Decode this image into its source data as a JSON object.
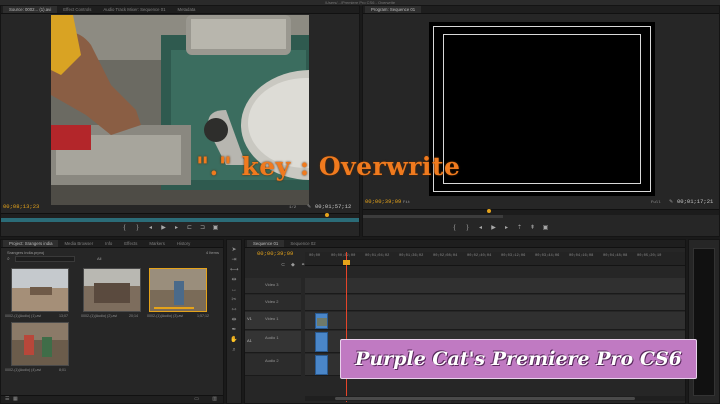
{
  "title_bar": "/Users/.../Premiere Pro CS6 - Overwrite",
  "source_monitor": {
    "tabs": [
      "Source: 0002... (1).avi",
      "Effect Controls",
      "Audio Track Mixer: Sequence 01",
      "Metadata"
    ],
    "timecode_in": "00;08;13;23",
    "fit": "1/2",
    "timecode_out": "00;01;57;12"
  },
  "program_monitor": {
    "tabs": [
      "Program: Sequence 01"
    ],
    "timecode_in": "00;00;39;09",
    "fit": "Fit",
    "zoom": "Full",
    "timecode_out": "00;01;17;21"
  },
  "overlay_caption": "\".\" key : Overwrite",
  "watermark": "Purple Cat's Premiere Pro CS6",
  "project_panel": {
    "tabs": [
      "Project: Srangers india",
      "Media Browser",
      "Info",
      "Effects",
      "Markers",
      "History"
    ],
    "project_file": "Srangers india.prproj",
    "item_count": "4 Items",
    "filter": "All",
    "clips": [
      {
        "name": "0002-(1)(Audio) (1).avi",
        "duration": "13;07"
      },
      {
        "name": "0002-(1)(Audio) (2).avi",
        "duration": "20;14"
      },
      {
        "name": "0002-(1)(Audio) (3).avi",
        "duration": "1;57;12"
      },
      {
        "name": "0002-(1)(Audio) (4).avi",
        "duration": "8;01"
      }
    ]
  },
  "timeline": {
    "tabs": [
      "Sequence 01",
      "Sequence 02"
    ],
    "timecode": "00;00;39;09",
    "ruler": [
      "00;00",
      "00;00;32;00",
      "00;01;04;02",
      "00;01;36;02",
      "00;02;08;04",
      "00;02;40;04",
      "00;03;12;06",
      "00;03;44;06",
      "00;04;16;08",
      "00;04;48;08",
      "00;05;20;10"
    ],
    "tracks": [
      {
        "name": "Video 3",
        "type": "video"
      },
      {
        "name": "Video 2",
        "type": "video"
      },
      {
        "name": "Video 1",
        "type": "video"
      },
      {
        "name": "Audio 1",
        "type": "audio"
      },
      {
        "name": "Audio 2",
        "type": "audio"
      }
    ],
    "side_labels": [
      "V1",
      "A1"
    ]
  },
  "colors": {
    "accent": "#e5a31a",
    "caption": "#f07a1e",
    "watermark_bg": "#c07ac2",
    "clip_blue": "#4a86c8"
  }
}
